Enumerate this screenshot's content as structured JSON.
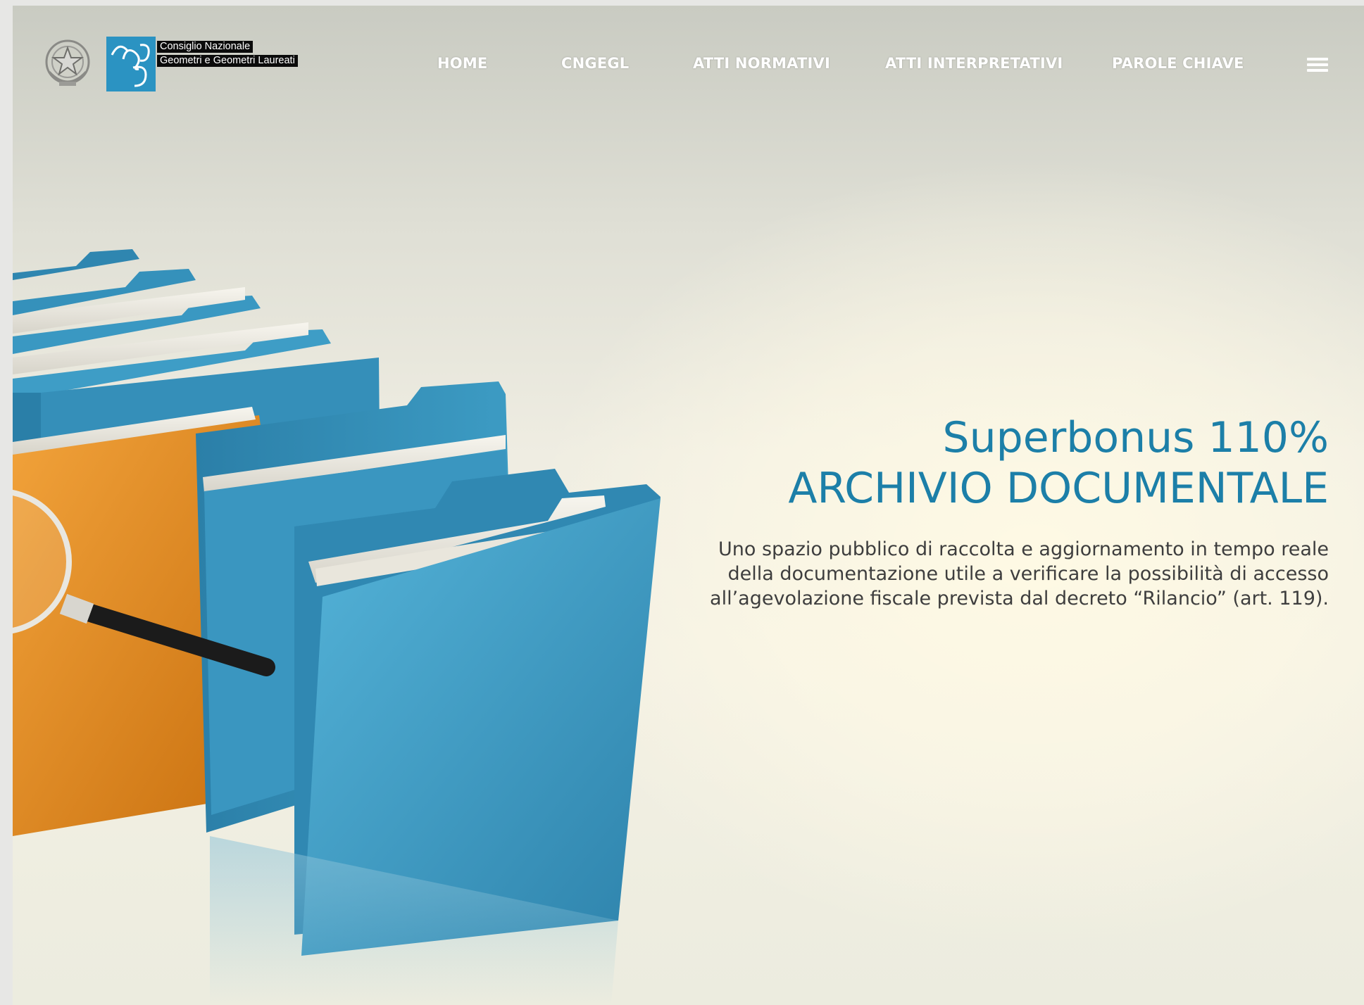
{
  "header": {
    "logo_lines": [
      "Consiglio Nazionale",
      "Geometri e Geometri Laureati"
    ],
    "nav": [
      {
        "label": "HOME"
      },
      {
        "label": "CNGEGL"
      },
      {
        "label": "ATTI NORMATIVI"
      },
      {
        "label": "ATTI INTERPRETATIVI"
      },
      {
        "label": "PAROLE CHIAVE"
      }
    ],
    "menu_icon": "hamburger-icon"
  },
  "hero": {
    "title_line1": "Superbonus 110%",
    "title_line2": "ARCHIVIO DOCUMENTALE",
    "description": "Uno spazio pubblico di raccolta e aggiornamento in tempo reale della documentazione utile a verificare la possibilità di accesso all’agevolazione fiscale prevista dal decreto “Rilancio” (art. 119)."
  },
  "colors": {
    "accent": "#1c7fa8",
    "logo_blue": "#2b93c2",
    "folder_blue": "#3d9cc4",
    "folder_orange": "#e08a1e",
    "text": "#3e3e3e"
  }
}
